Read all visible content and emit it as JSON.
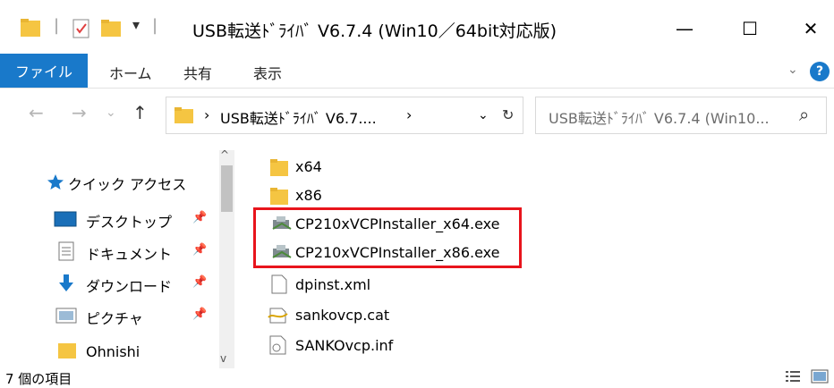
{
  "window": {
    "title": "USB転送ﾄﾞﾗｲﾊﾞ V6.7.4 (Win10／64bit対応版)",
    "controls": {
      "minimize": "—",
      "maximize": "☐",
      "close": "✕"
    }
  },
  "quick_access": {
    "separator": "|",
    "dropdown": "▾"
  },
  "ribbon": {
    "tabs": [
      {
        "label": "ファイル"
      },
      {
        "label": "ホーム"
      },
      {
        "label": "共有"
      },
      {
        "label": "表示"
      }
    ],
    "collapse": "⌄",
    "help": "?"
  },
  "address": {
    "back": "←",
    "forward": "→",
    "recent": "⌄",
    "up": "↑",
    "crumb_arrow": "›",
    "path": "USB転送ﾄﾞﾗｲﾊﾞ V6.7....",
    "more": "›",
    "dropdown": "⌄",
    "refresh": "↻"
  },
  "search": {
    "placeholder": "USB転送ﾄﾞﾗｲﾊﾞ V6.7.4 (Win10...",
    "icon": "⌕"
  },
  "nav_pane": {
    "items": [
      {
        "label": "クイック アクセス",
        "icon": "star-icon"
      },
      {
        "label": "デスクトップ",
        "icon": "desktop-icon",
        "pinned": true
      },
      {
        "label": "ドキュメント",
        "icon": "document-icon",
        "pinned": true
      },
      {
        "label": "ダウンロード",
        "icon": "download-icon",
        "pinned": true
      },
      {
        "label": "ピクチャ",
        "icon": "pictures-icon",
        "pinned": true
      },
      {
        "label": "Ohnishi",
        "icon": "folder-icon"
      }
    ],
    "pin_glyph": "📌",
    "scroll_up": "^",
    "scroll_down": "v"
  },
  "files": [
    {
      "name": "x64",
      "type": "folder",
      "highlighted": false
    },
    {
      "name": "x86",
      "type": "folder",
      "highlighted": false
    },
    {
      "name": "CP210xVCPInstaller_x64.exe",
      "type": "exe",
      "highlighted": true
    },
    {
      "name": "CP210xVCPInstaller_x86.exe",
      "type": "exe",
      "highlighted": true
    },
    {
      "name": "dpinst.xml",
      "type": "xml",
      "highlighted": false
    },
    {
      "name": "sankovcp.cat",
      "type": "cat",
      "highlighted": false
    },
    {
      "name": "SANKOvcp.inf",
      "type": "inf",
      "highlighted": false
    }
  ],
  "status": {
    "item_count": "7 個の項目"
  },
  "colors": {
    "accent": "#1979ca",
    "highlight_border": "#e8141c",
    "folder": "#f5c542"
  }
}
